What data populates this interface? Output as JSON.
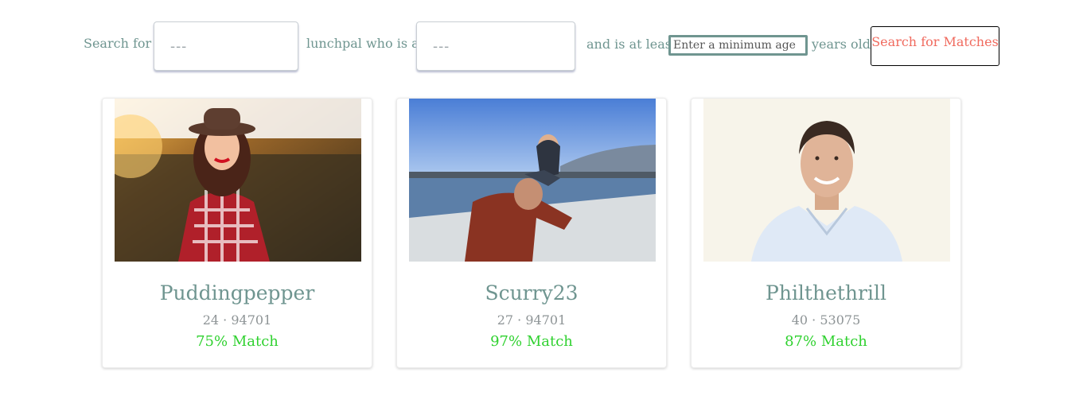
{
  "search": {
    "label_search_for": "Search for a",
    "select1_value": "---",
    "label_lunchpal": "lunchpal who is an",
    "select2_value": "---",
    "label_at_least": "and is at least",
    "age_placeholder": "Enter a minimum age",
    "label_years_old": "years old.",
    "button_label": "Search for Matches"
  },
  "cards": [
    {
      "name": "Puddingpepper",
      "age": "24",
      "separator": "·",
      "zip": "94701",
      "match": "75% Match"
    },
    {
      "name": "Scurry23",
      "age": "27",
      "separator": "·",
      "zip": "94701",
      "match": "97% Match"
    },
    {
      "name": "Philthethrill",
      "age": "40",
      "separator": "·",
      "zip": "53075",
      "match": "87% Match"
    }
  ],
  "colors": {
    "text_teal": "#6f9590",
    "button_text": "#f06a5e",
    "match_green": "#2fd12f",
    "meta_gray": "#8e9496"
  }
}
